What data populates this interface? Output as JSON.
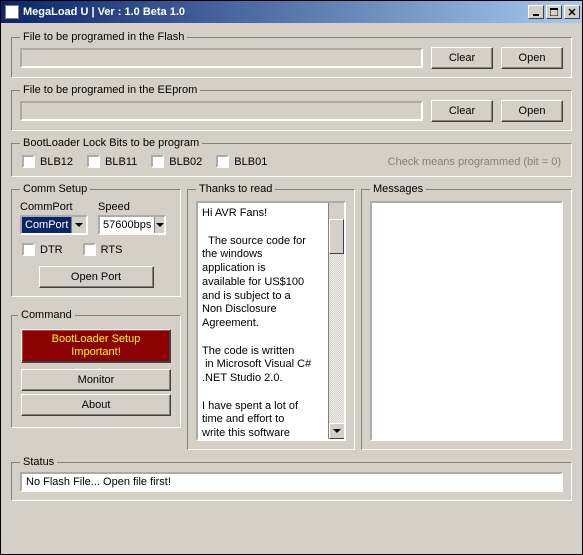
{
  "window": {
    "title": "MegaLoad U  |  Ver : 1.0 Beta 1.0"
  },
  "flash": {
    "legend": "File to be programed in the Flash",
    "path": "",
    "clear": "Clear",
    "open": "Open"
  },
  "eeprom": {
    "legend": "File to be programed in the EEprom",
    "path": "",
    "clear": "Clear",
    "open": "Open"
  },
  "lockbits": {
    "legend": "BootLoader Lock Bits to be program",
    "blb12": "BLB12",
    "blb11": "BLB11",
    "blb02": "BLB02",
    "blb01": "BLB01",
    "hint": "Check means programmed (bit = 0)"
  },
  "comm": {
    "legend": "Comm Setup",
    "port_label": "CommPort",
    "port_value": "ComPort",
    "speed_label": "Speed",
    "speed_value": "57600bps",
    "dtr": "DTR",
    "rts": "RTS",
    "open_port": "Open Port"
  },
  "command": {
    "legend": "Command",
    "bootloader": "BootLoader Setup\nImportant!",
    "monitor": "Monitor",
    "about": "About"
  },
  "thanks": {
    "legend": "Thanks to read",
    "text": "Hi AVR Fans!\n\n  The source code for\nthe windows\napplication is\navailable for US$100\nand is subject to a\nNon Disclosure\nAgreement.\n\nThe code is written\n in Microsoft Visual C#\n.NET Studio 2.0.\n\nI have spent a lot of\ntime and effort to\nwrite this software\nand I would be\npleased to receive"
  },
  "messages": {
    "legend": "Messages",
    "text": ""
  },
  "status": {
    "legend": "Status",
    "text": "No Flash File...  Open file first!"
  }
}
